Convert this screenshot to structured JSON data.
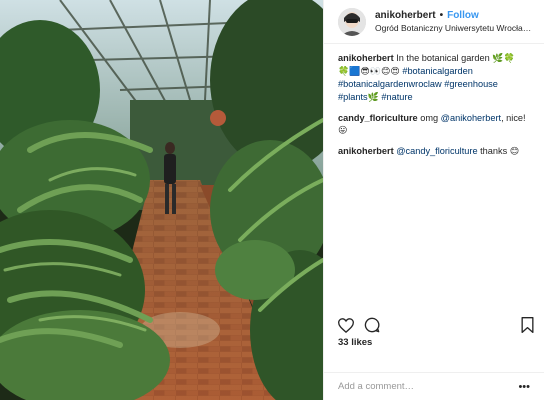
{
  "post": {
    "username": "anikoherbert",
    "follow_label": "Follow",
    "separator": "•",
    "location": "Ogród Botaniczny Uniwersytetu Wrocławskiego",
    "caption": {
      "username": "anikoherbert",
      "text": "In the botanical garden",
      "emojis_1": "🌿🍀",
      "emojis_2": "🍀🟦😎👀😊😍",
      "hashtags": [
        "#botanicalgarden",
        "#botanicalgardenwroclaw",
        "#greenhouse",
        "#plants",
        "#nature"
      ],
      "emoji_leaf": "🌿"
    },
    "comments": [
      {
        "username": "candy_floriculture",
        "text_before": "omg",
        "mention": "@anikoherbert",
        "text_after": ", nice!",
        "emoji": "😛"
      },
      {
        "username": "anikoherbert",
        "mention": "@candy_floriculture",
        "text_after": "thanks",
        "emoji": "😊"
      }
    ],
    "likes_text": "33 likes",
    "comment_placeholder": "Add a comment…",
    "more_label": "•••"
  },
  "icons": {
    "heart": "heart-icon",
    "comment": "comment-icon",
    "save": "bookmark-icon"
  }
}
